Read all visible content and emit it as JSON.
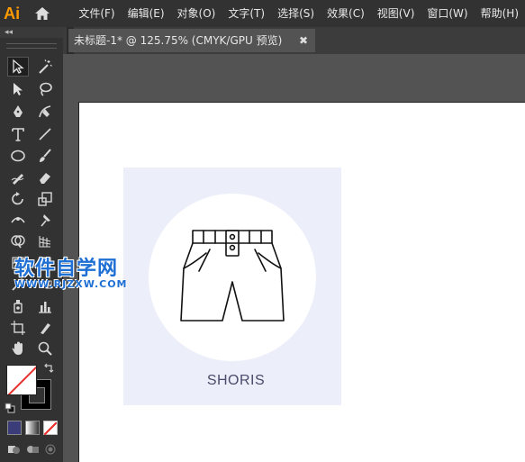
{
  "app": {
    "logo_text": "Ai",
    "accent": "#ff9a00"
  },
  "menu": {
    "items": [
      "文件(F)",
      "编辑(E)",
      "对象(O)",
      "文字(T)",
      "选择(S)",
      "效果(C)",
      "视图(V)",
      "窗口(W)",
      "帮助(H)"
    ]
  },
  "toolbar": {
    "collapse_label": "◂◂"
  },
  "document": {
    "tab_title": "未标题-1* @ 125.75% (CMYK/GPU 预览)",
    "close_label": "✖"
  },
  "artwork": {
    "label": "SHORIS",
    "card_color": "#eceef9",
    "icon": "shorts-icon"
  },
  "watermark": {
    "main": "软件自学网",
    "sub": "WWW.RJZXW.COM",
    "color": "#1e6fd4"
  }
}
